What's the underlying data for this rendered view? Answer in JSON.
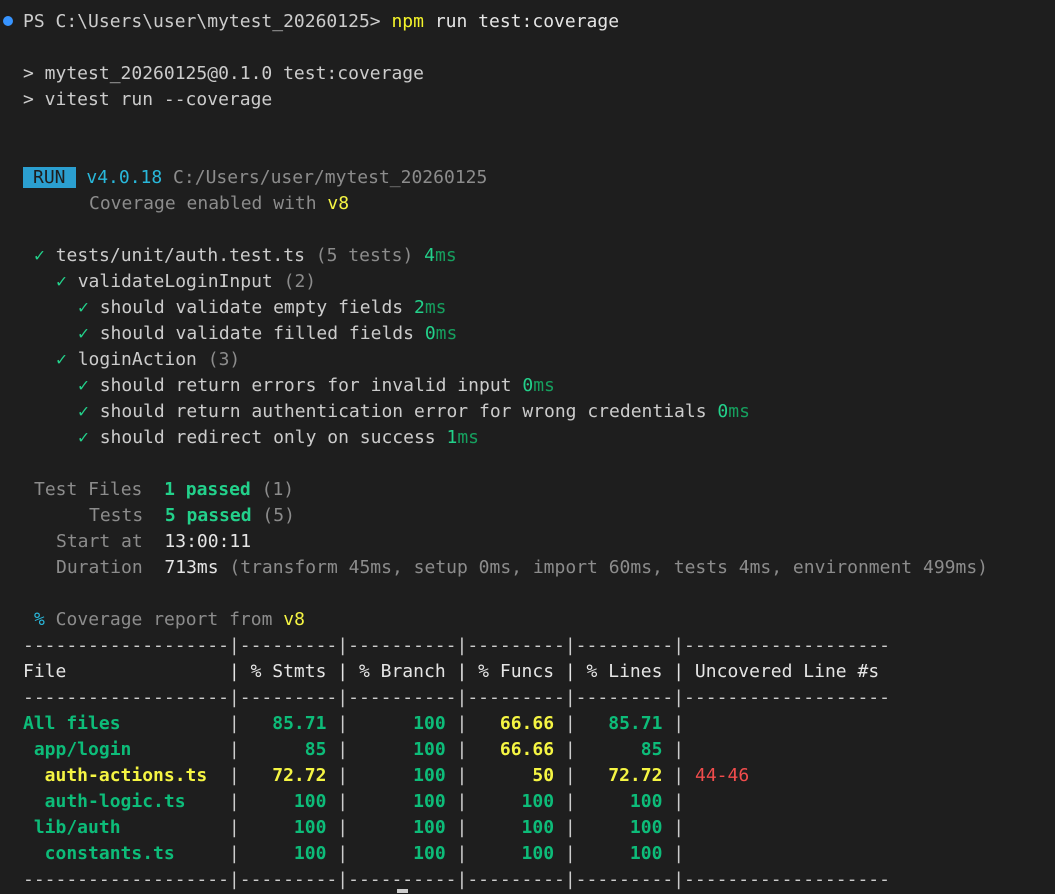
{
  "prompt": {
    "prefix": "PS C:\\Users\\user\\mytest_20260125> ",
    "cmd": "npm",
    "args": " run test:coverage"
  },
  "script_lines": [
    "> mytest_20260125@0.1.0 test:coverage",
    "> vitest run --coverage"
  ],
  "run": {
    "badge": "RUN",
    "version": "v4.0.18",
    "path": " C:/Users/user/mytest_20260125",
    "cov_text": "Coverage enabled with ",
    "cov_provider": "v8"
  },
  "suite": {
    "mark": "✓",
    "file": "tests/unit/auth.test.ts",
    "count": " (5 tests) ",
    "time_num": "4",
    "time_unit": "ms"
  },
  "groups": [
    {
      "name": "validateLoginInput",
      "count": " (2)",
      "tests": [
        {
          "name": "should validate empty fields",
          "n": "2",
          "u": "ms"
        },
        {
          "name": "should validate filled fields",
          "n": "0",
          "u": "ms"
        }
      ]
    },
    {
      "name": "loginAction",
      "count": " (3)",
      "tests": [
        {
          "name": "should return errors for invalid input",
          "n": "0",
          "u": "ms"
        },
        {
          "name": "should return authentication error for wrong credentials",
          "n": "0",
          "u": "ms"
        },
        {
          "name": "should redirect only on success",
          "n": "1",
          "u": "ms"
        }
      ]
    }
  ],
  "summary": {
    "files_label": "Test Files",
    "files_value": "1 passed",
    "files_total": " (1)",
    "tests_label": "Tests",
    "tests_value": "5 passed",
    "tests_total": " (5)",
    "start_label": "Start at",
    "start_value": "13:00:11",
    "dur_label": "Duration",
    "dur_value": "713ms",
    "dur_detail": " (transform 45ms, setup 0ms, import 60ms, tests 4ms, environment 499ms)"
  },
  "coverage": {
    "pct": "%",
    "title": " Coverage report from ",
    "provider": "v8",
    "separator": "-------------------|---------|----------|---------|---------|-------------------",
    "header": [
      "File",
      "% Stmts",
      "% Branch",
      "% Funcs",
      "% Lines",
      "Uncovered Line #s"
    ],
    "rows": [
      {
        "file": "All files",
        "stmts": "85.71",
        "branch": "100",
        "funcs": "66.66",
        "lines": "85.71",
        "uncovered": "",
        "indent": 0
      },
      {
        "file": "app/login",
        "stmts": "85",
        "branch": "100",
        "funcs": "66.66",
        "lines": "85",
        "uncovered": "",
        "indent": 1
      },
      {
        "file": "auth-actions.ts",
        "stmts": "72.72",
        "branch": "100",
        "funcs": "50",
        "lines": "72.72",
        "uncovered": "44-46",
        "indent": 2
      },
      {
        "file": "auth-logic.ts",
        "stmts": "100",
        "branch": "100",
        "funcs": "100",
        "lines": "100",
        "uncovered": "",
        "indent": 2
      },
      {
        "file": "lib/auth",
        "stmts": "100",
        "branch": "100",
        "funcs": "100",
        "lines": "100",
        "uncovered": "",
        "indent": 1
      },
      {
        "file": "constants.ts",
        "stmts": "100",
        "branch": "100",
        "funcs": "100",
        "lines": "100",
        "uncovered": "",
        "indent": 2
      }
    ]
  },
  "colors": {
    "background": "#1e1e1e",
    "text": "#cccccc",
    "pass": "#23d18b",
    "warn": "#f5f543",
    "fail": "#f14c4c",
    "badge": "#2b9fd0"
  }
}
